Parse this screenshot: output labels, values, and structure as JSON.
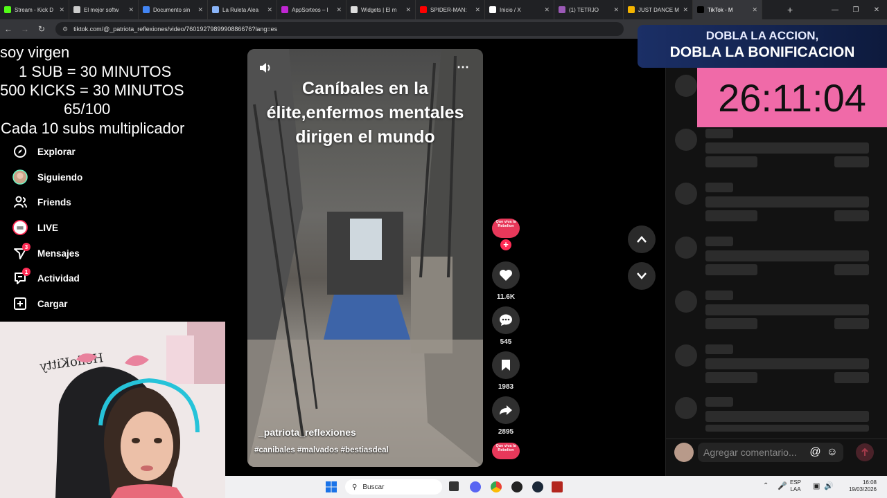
{
  "browser": {
    "tabs": [
      {
        "label": "Stream - Kick D",
        "color": "#53fc18"
      },
      {
        "label": "El mejor softw",
        "color": "#cccccc"
      },
      {
        "label": "Documento sin",
        "color": "#4285f4"
      },
      {
        "label": "La Ruleta Alea",
        "color": "#8ab4f8"
      },
      {
        "label": "AppSorteos – l",
        "color": "#c026d3"
      },
      {
        "label": "Widgets | El m",
        "color": "#dddddd"
      },
      {
        "label": "SPIDER-MAN:",
        "color": "#ff0000"
      },
      {
        "label": "Inicio / X",
        "color": "#ffffff"
      },
      {
        "label": "(1) TETRJO",
        "color": "#9b59b6"
      },
      {
        "label": "JUST DANCE M",
        "color": "#f4b400"
      },
      {
        "label": "TikTok - M",
        "color": "#000000"
      }
    ],
    "new_tab": "+",
    "url": "tiktok.com/@_patriota_reflexiones/video/7601927989990886676?lang=es"
  },
  "overlay": {
    "line1": "soy virgen",
    "line2": "1 SUB      = 30 MINUTOS",
    "line3": "500 KICKS = 30 MINUTOS",
    "line4": "65/100",
    "line5": "Cada 10 subs multiplicador",
    "promo_top": "DOBLA LA ACCION,",
    "promo_bottom": "DOBLA LA BONIFICACION",
    "timer": "26:11:04"
  },
  "sidebar": {
    "items": [
      {
        "label": "Explorar"
      },
      {
        "label": "Siguiendo"
      },
      {
        "label": "Friends"
      },
      {
        "label": "LIVE"
      },
      {
        "label": "Mensajes",
        "badge": "3"
      },
      {
        "label": "Actividad",
        "badge": "1"
      },
      {
        "label": "Cargar"
      }
    ]
  },
  "video": {
    "title": "Caníbales en la élite,enfermos mentales dirigen el mundo",
    "author": "_patriota_reflexiones",
    "hashtags": "#canibales #malvados #bestiasdeal",
    "author_avatar_text": "Que viva la Rebelion"
  },
  "actions": {
    "likes": "11.6K",
    "comments": "545",
    "saves": "1983",
    "shares": "2895"
  },
  "comments": {
    "placeholder": "Agregar comentario..."
  },
  "taskbar": {
    "search": "Buscar",
    "lang_top": "ESP",
    "lang_bottom": "LAA",
    "time": "16:08",
    "date": "19/03/2026"
  },
  "colors": {
    "accent": "#fe2c55",
    "timer_bg": "#f06aa8"
  }
}
